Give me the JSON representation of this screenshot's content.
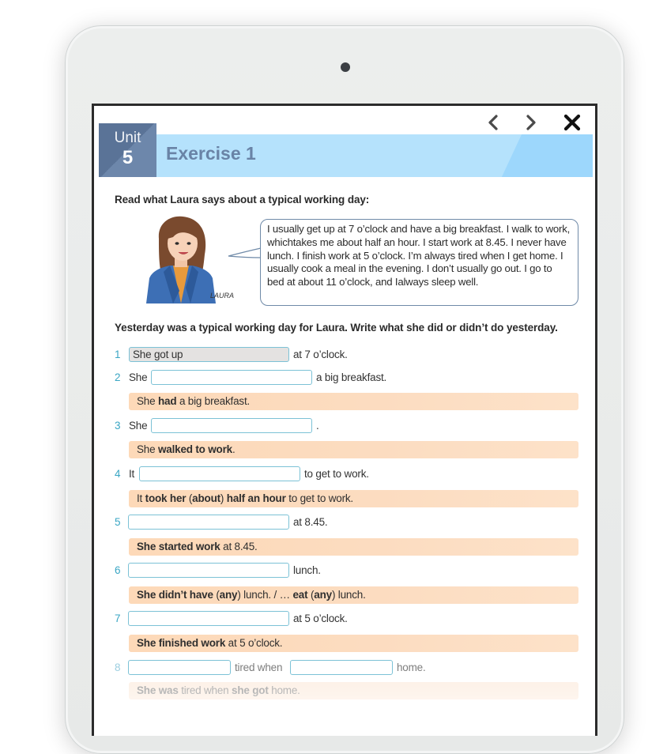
{
  "header": {
    "unit_label": "Unit",
    "unit_number": "5",
    "title": "Exercise 1",
    "nav": {
      "prev_icon": "chevron-left-icon",
      "next_icon": "chevron-right-icon",
      "close_icon": "close-icon"
    }
  },
  "intro": {
    "instruction": "Read what Laura says about a typical working day:",
    "character_name": "LAURA",
    "speech": "I usually get up at 7 o’clock and have a big breakfast.  I walk to work, whichtakes me about half an hour.  I start work at 8.45.  I never have lunch.  I finish work at 5 o’clock.  I’m always tired when I get home.  I usually cook a meal in the evening.  I don’t usually go out.  I go to bed at about 11 o’clock, and Ialways sleep well."
  },
  "task": {
    "instruction": "Yesterday was a typical working day for Laura.  Write what she did or didn’t do yesterday."
  },
  "items": [
    {
      "number": "1",
      "prefix": "",
      "field_value": "She got up",
      "field_placeholder": "",
      "suffix": "at 7 o’clock."
    },
    {
      "number": "2",
      "prefix": "She",
      "field_value": "",
      "suffix": "a big breakfast.",
      "answer": [
        {
          "t": "She ",
          "b": false
        },
        {
          "t": "had",
          "b": true
        },
        {
          "t": " a big breakfast.",
          "b": false
        }
      ]
    },
    {
      "number": "3",
      "prefix": "She",
      "field_value": "",
      "suffix": ".",
      "answer": [
        {
          "t": "She ",
          "b": false
        },
        {
          "t": "walked to work",
          "b": true
        },
        {
          "t": ".",
          "b": false
        }
      ]
    },
    {
      "number": "4",
      "prefix": "It",
      "field_value": "",
      "suffix": "to get to work.",
      "answer": [
        {
          "t": "It ",
          "b": false
        },
        {
          "t": "took her",
          "b": true
        },
        {
          "t": " (",
          "b": false
        },
        {
          "t": "about",
          "b": true
        },
        {
          "t": ") ",
          "b": false
        },
        {
          "t": "half an hour",
          "b": true
        },
        {
          "t": " to get to work.",
          "b": false
        }
      ]
    },
    {
      "number": "5",
      "prefix": "",
      "field_value": "",
      "suffix": "at 8.45.",
      "answer": [
        {
          "t": "She started work",
          "b": true
        },
        {
          "t": " at 8.45.",
          "b": false
        }
      ]
    },
    {
      "number": "6",
      "prefix": "",
      "field_value": "",
      "suffix": "lunch.",
      "answer": [
        {
          "t": "She didn’t have",
          "b": true
        },
        {
          "t": " (",
          "b": false
        },
        {
          "t": "any",
          "b": true
        },
        {
          "t": ") lunch. / … ",
          "b": false
        },
        {
          "t": "eat",
          "b": true
        },
        {
          "t": " (",
          "b": false
        },
        {
          "t": "any",
          "b": true
        },
        {
          "t": ") lunch.",
          "b": false
        }
      ]
    },
    {
      "number": "7",
      "prefix": "",
      "field_value": "",
      "suffix": "at 5 o’clock.",
      "answer": [
        {
          "t": "She finished work",
          "b": true
        },
        {
          "t": " at 5 o’clock.",
          "b": false
        }
      ]
    },
    {
      "number": "8",
      "prefix": "",
      "field_value": "",
      "middle": "tired when",
      "field2_value": "",
      "suffix": "home.",
      "answer": [
        {
          "t": "She ",
          "b": true
        },
        {
          "t": "was",
          "b": true
        },
        {
          "t": " tired when ",
          "b": false
        },
        {
          "t": "she got",
          "b": true
        },
        {
          "t": " home.",
          "b": false
        }
      ]
    }
  ],
  "colors": {
    "unit_box": "#5a7397",
    "title_bar": "#b5e2fc",
    "title_text": "#6983a6",
    "item_number": "#3aa6c4",
    "field_border": "#7cc2d6",
    "answer_bg": "#fdd9b8"
  }
}
